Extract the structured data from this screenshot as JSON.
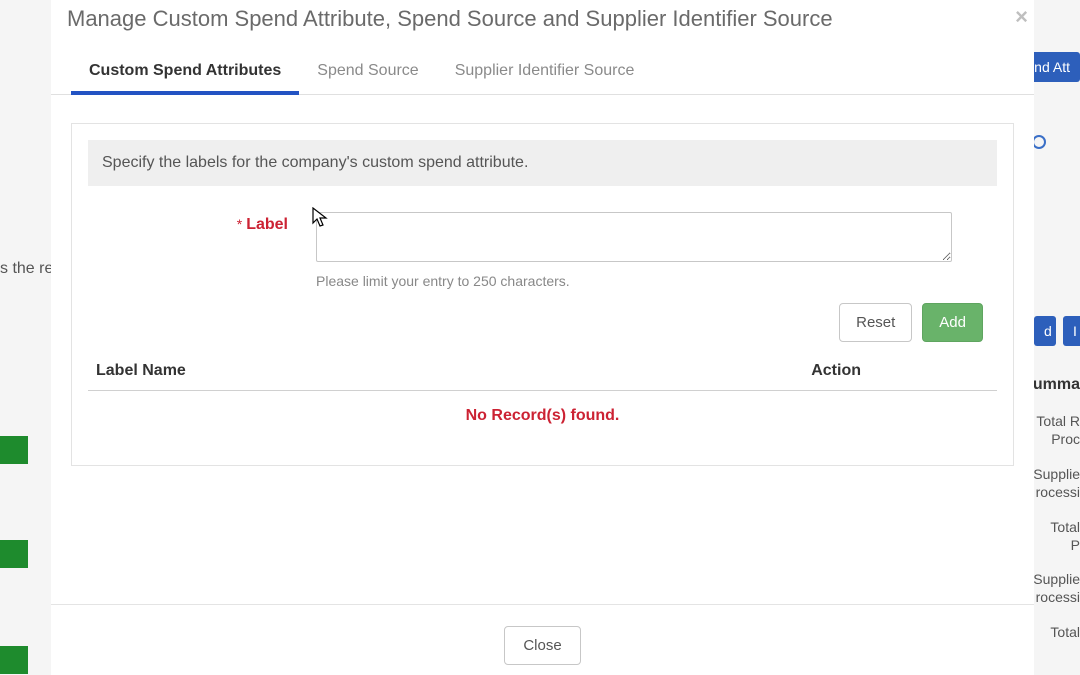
{
  "background": {
    "results_text": "s the resul",
    "spend_attr_btn": "pend Att",
    "d_btn": "d",
    "i_btn": "I",
    "summa": "Summa",
    "lines": [
      "Total R",
      "Proc",
      "Supplie",
      "rocessi",
      "Total",
      "P",
      "Supplie",
      "rocessi",
      "Total"
    ]
  },
  "modal": {
    "title": "Manage Custom Spend Attribute, Spend Source and Supplier Identifier Source"
  },
  "tabs": {
    "items": [
      {
        "label": "Custom Spend Attributes",
        "active": true
      },
      {
        "label": "Spend Source",
        "active": false
      },
      {
        "label": "Supplier Identifier Source",
        "active": false
      }
    ]
  },
  "panel": {
    "info": "Specify the labels for the company's custom spend attribute.",
    "form": {
      "required_mark": "*",
      "label": "Label",
      "value": "",
      "hint": "Please limit your entry to 250 characters."
    },
    "buttons": {
      "reset": "Reset",
      "add": "Add"
    },
    "table": {
      "col_label": "Label Name",
      "col_action": "Action",
      "empty": "No Record(s) found."
    }
  },
  "footer": {
    "close": "Close"
  }
}
